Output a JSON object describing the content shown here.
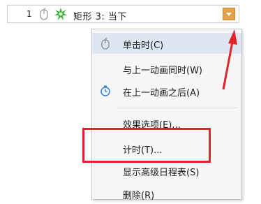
{
  "animation_item": {
    "order": "1",
    "name": "矩形 3: 当下",
    "icons": [
      "mouse-icon",
      "star-burst-icon",
      "dropdown-arrow-icon"
    ],
    "dropdown_color": "#e6a24a"
  },
  "menu": {
    "items": [
      {
        "label": "单击时(C)",
        "icon": "mouse-icon",
        "highlighted": true
      },
      {
        "label": "与上一动画同时(W)",
        "icon": ""
      },
      {
        "label": "在上一动画之后(A)",
        "icon": "clock-icon"
      },
      {
        "label": "效果选项(E)...",
        "icon": ""
      },
      {
        "label": "计时(T)...",
        "icon": ""
      },
      {
        "label": "显示高级日程表(S)",
        "icon": ""
      },
      {
        "label": "删除(R)",
        "icon": ""
      }
    ]
  },
  "annotation_color": "#e3212b"
}
